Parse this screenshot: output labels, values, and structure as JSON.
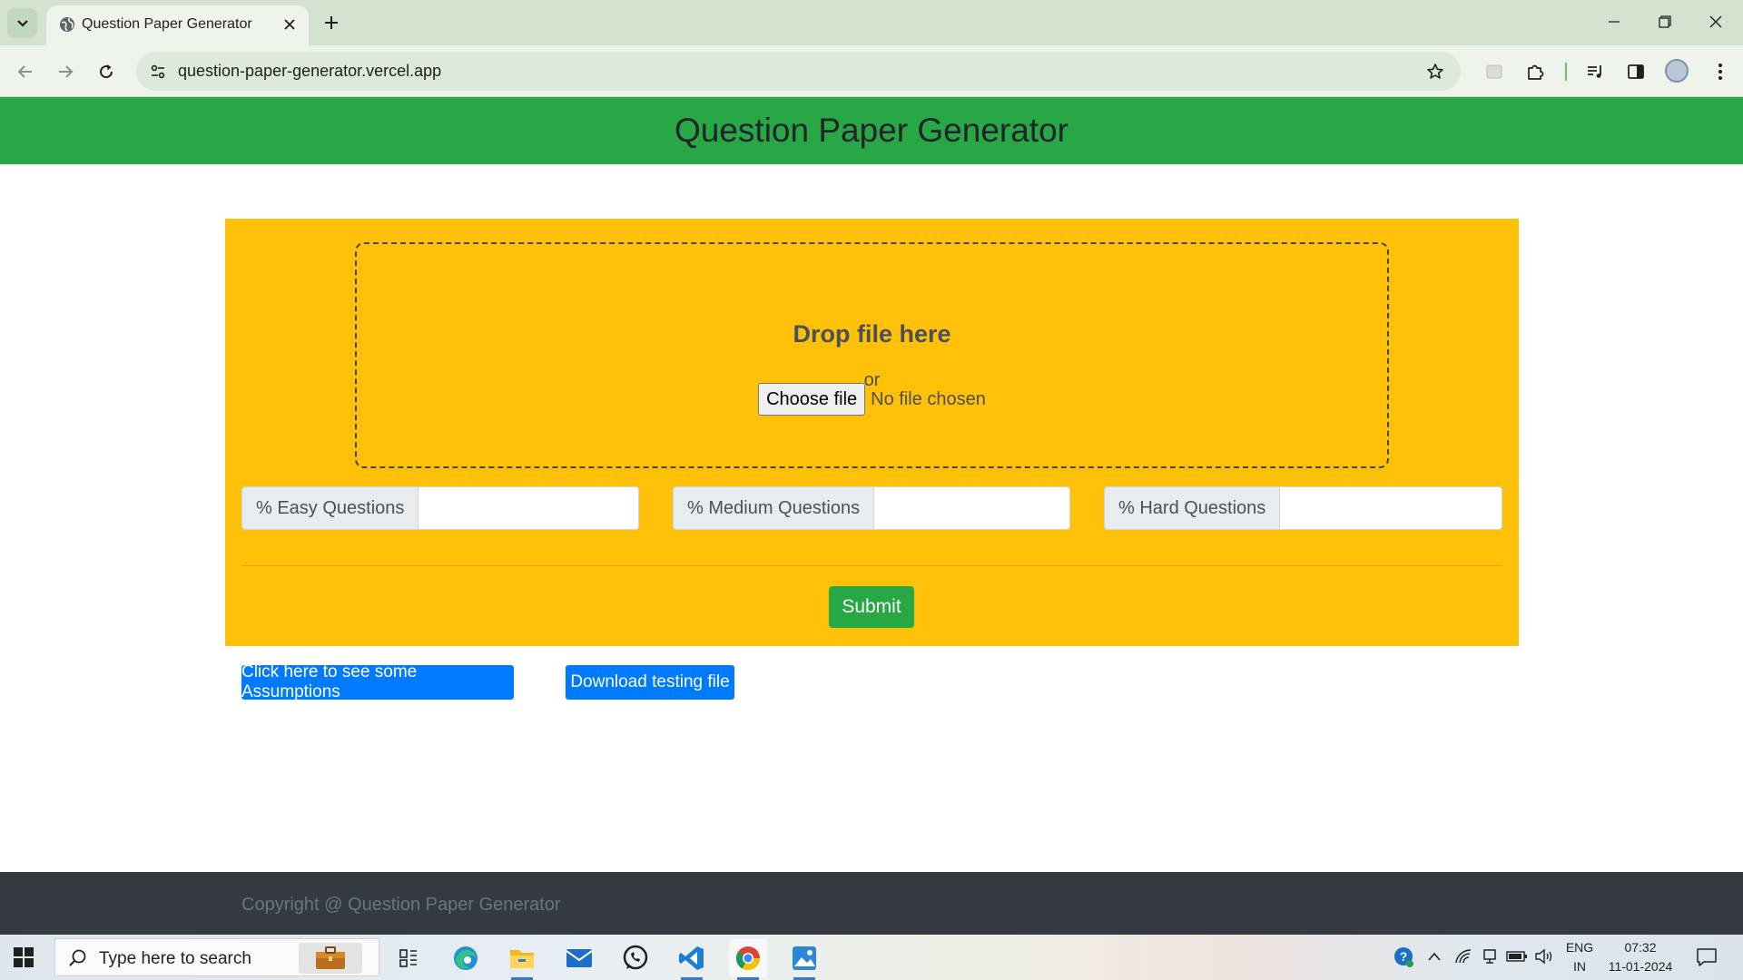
{
  "browser": {
    "tab_title": "Question Paper Generator",
    "url": "question-paper-generator.vercel.app"
  },
  "page": {
    "header_title": "Question Paper Generator",
    "dropzone": {
      "title": "Drop file here",
      "or_text": "or",
      "choose_file_label": "Choose file",
      "no_file_text": "No file chosen"
    },
    "inputs": {
      "easy_label": "% Easy Questions",
      "easy_value": "",
      "medium_label": "% Medium Questions",
      "medium_value": "",
      "hard_label": "% Hard Questions",
      "hard_value": ""
    },
    "submit_label": "Submit",
    "assumptions_button": "Click here to see some Assumptions",
    "download_button": "Download testing file",
    "footer_text": "Copyright @ Question Paper Generator"
  },
  "taskbar": {
    "search_placeholder": "Type here to search",
    "language": "ENG",
    "region": "IN",
    "time": "07:32",
    "date": "11-01-2024"
  },
  "colors": {
    "header_green": "#28a745",
    "card_yellow": "#ffc107",
    "button_blue": "#007bff",
    "footer_dark": "#343a40"
  }
}
